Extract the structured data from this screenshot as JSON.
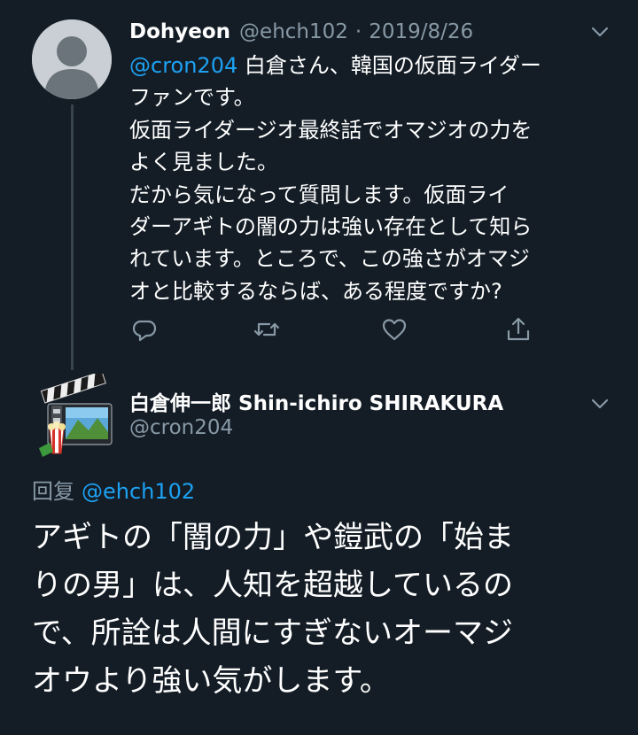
{
  "colors": {
    "background": "#141d26",
    "text": "#ffffff",
    "muted": "#8899a6",
    "link": "#1da1f2",
    "thread_line": "#38444d"
  },
  "tweet1": {
    "display_name": "Dohyeon",
    "handle": "@ehch102",
    "separator": "·",
    "date": "2019/8/26",
    "mention": "@cron204",
    "body": " 白倉さん、韓国の仮面ライダー\nファンです。\n仮面ライダージオ最終話でオマジオの力を\nよく見ました。\nだから気になって質問します。仮面ライ\nダーアギトの闇の力は強い存在として知ら\nれています。ところで、この強さがオマジ\nオと比較するならば、ある程度ですか?",
    "avatar_icon": "default-profile-icon",
    "menu_icon": "chevron-down-icon",
    "action_icons": [
      "reply-icon",
      "retweet-icon",
      "like-icon",
      "share-icon"
    ]
  },
  "tweet2": {
    "display_name": "白倉伸一郎 Shin-ichiro SHIRAKURA",
    "handle": "@cron204",
    "reply_prefix": "回复",
    "reply_to": "@ehch102",
    "body": "アギトの「闇の力」や鎧武の「始ま\nりの男」は、人知を超越しているの\nで、所詮は人間にすぎないオーマジ\nオウより強い気がします。",
    "avatar_icon": "clapperboard-film-icon",
    "menu_icon": "chevron-down-icon"
  }
}
